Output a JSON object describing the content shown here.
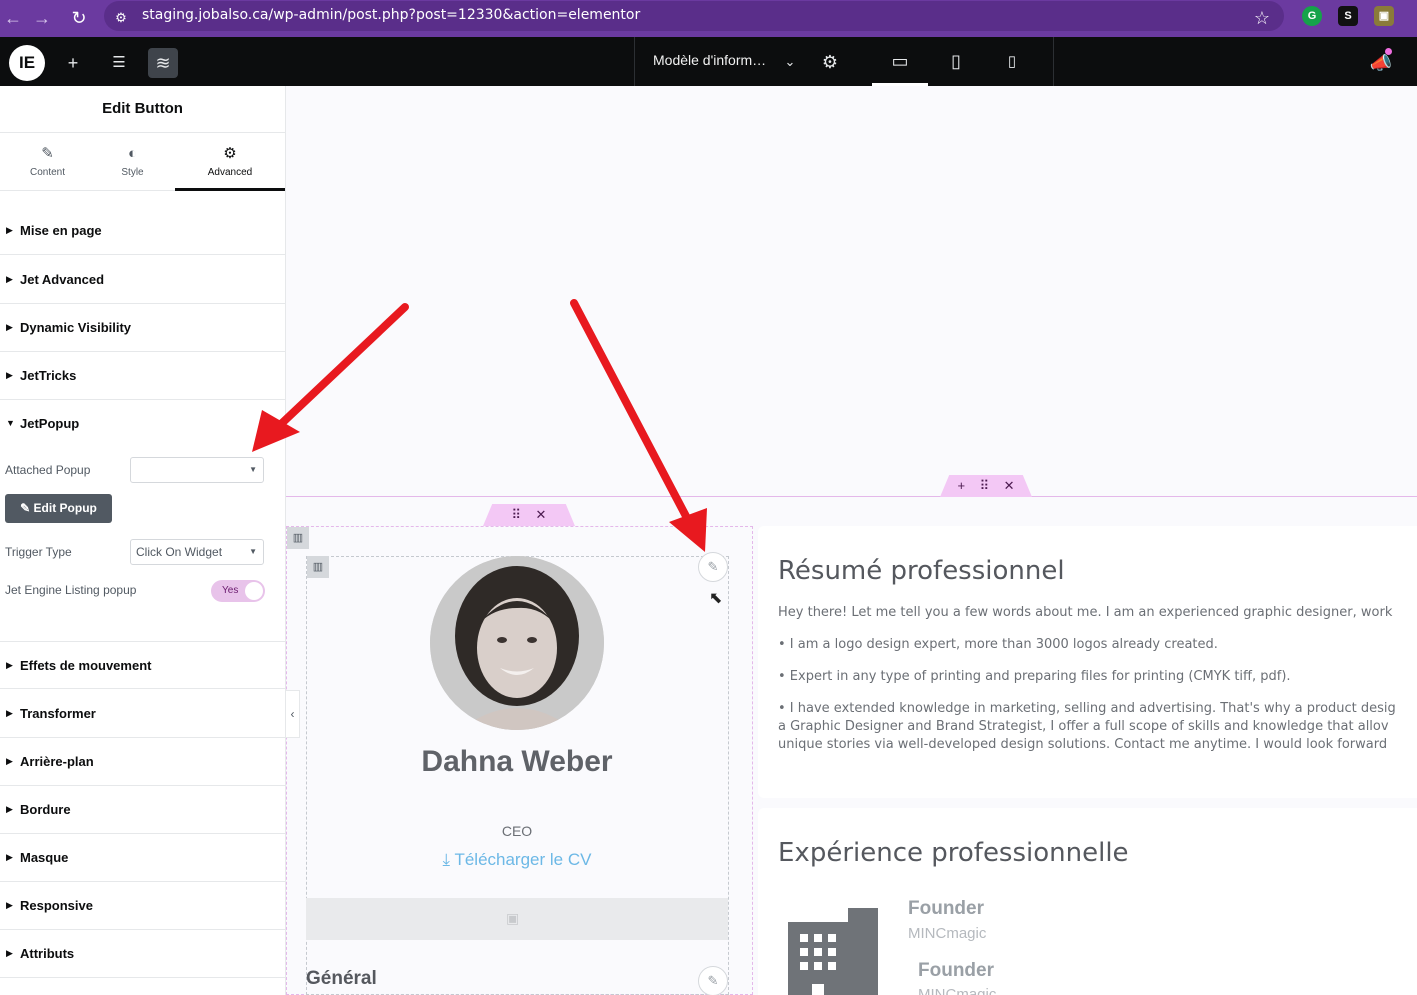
{
  "browser": {
    "url": "staging.jobalso.ca/wp-admin/post.php?post=12330&action=elementor"
  },
  "topbar": {
    "document_title": "Modèle d'inform…"
  },
  "panel": {
    "title": "Edit Button",
    "tabs": [
      {
        "label": "Content",
        "icon": "pencil-icon"
      },
      {
        "label": "Style",
        "icon": "contrast-icon"
      },
      {
        "label": "Advanced",
        "icon": "gear-icon"
      }
    ],
    "sections_top": [
      "Mise en page",
      "Jet Advanced",
      "Dynamic Visibility",
      "JetTricks"
    ],
    "open_section": "JetPopup",
    "attached_popup_label": "Attached Popup",
    "attached_popup_value": "",
    "edit_popup_label": "Edit Popup",
    "trigger_type_label": "Trigger Type",
    "trigger_type_value": "Click On Widget",
    "listing_popup_label": "Jet Engine Listing popup",
    "listing_popup_value": "Yes",
    "sections_bottom": [
      "Effets de mouvement",
      "Transformer",
      "Arrière-plan",
      "Bordure",
      "Masque",
      "Responsive",
      "Attributs"
    ]
  },
  "profile": {
    "name": "Dahna Weber",
    "role": "CEO",
    "cv_link": "Télécharger le CV",
    "general_heading": "Général"
  },
  "resume": {
    "heading": "Résumé professionnel",
    "paragraphs": [
      "Hey there! Let me tell you a few words about me. I am an experienced graphic designer, work",
      "• I am a logo design expert, more than 3000 logos already created.",
      "• Expert in any type of printing and preparing files for printing (CMYK tiff, pdf).",
      "• I have extended knowledge in marketing, selling and advertising. That's why a product desig",
      "a Graphic Designer and Brand Strategist, I offer a full scope of skills and knowledge that allov",
      "unique stories via well-developed design solutions. Contact me anytime. I would look forward"
    ]
  },
  "experience": {
    "heading": "Expérience professionnelle",
    "items": [
      {
        "title": "Founder",
        "company": "MINCmagic"
      },
      {
        "title": "Founder",
        "company": "MINCmagic"
      }
    ]
  },
  "colors": {
    "browser_chrome": "#6b3aa0",
    "editor_bar": "#0c0d0e",
    "annotation_arrow": "#e8191f",
    "handle_pink": "#f3c8f5",
    "link_blue": "#6cb8e6"
  }
}
